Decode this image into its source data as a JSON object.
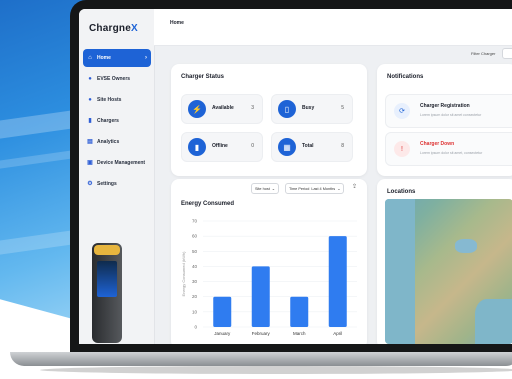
{
  "app": {
    "logo_text": "Chargne",
    "logo_accent": "X",
    "accent_color": "#1e63d6"
  },
  "sidebar": {
    "items": [
      {
        "label": "Home",
        "icon": "home-icon",
        "active": true
      },
      {
        "label": "EVSE Owners",
        "icon": "users-icon"
      },
      {
        "label": "Site Hosts",
        "icon": "user-group-icon"
      },
      {
        "label": "Chargers",
        "icon": "charger-icon"
      },
      {
        "label": "Analytics",
        "icon": "analytics-icon"
      },
      {
        "label": "Device Management",
        "icon": "device-icon"
      },
      {
        "label": "Settings",
        "icon": "gear-icon"
      }
    ]
  },
  "header": {
    "title": "Home",
    "filter_label": "Filter Charger"
  },
  "charger_status": {
    "title": "Charger Status",
    "items": [
      {
        "label": "Available",
        "value": "3",
        "icon": "plug-icon"
      },
      {
        "label": "Busy",
        "value": "5",
        "icon": "battery-icon"
      },
      {
        "label": "Offline",
        "value": "0",
        "icon": "charger-offline-icon"
      },
      {
        "label": "Total",
        "value": "8",
        "icon": "grid-icon"
      }
    ]
  },
  "notifications": {
    "title": "Notifications",
    "items": [
      {
        "title": "Charger Registration",
        "desc": "Lorem ipsum dolor sit amet consectetur",
        "icon": "registration-icon"
      },
      {
        "title": "Charger Down",
        "desc": "Lorem ipsum dolor sit amet, consectetur",
        "icon": "alert-icon"
      }
    ]
  },
  "energy": {
    "title": "Energy Consumed",
    "dropdown_site": "Site host",
    "dropdown_time_label": "Time Period",
    "dropdown_time_value": "Last 4 Months"
  },
  "locations": {
    "title": "Locations"
  },
  "chart_data": {
    "type": "bar",
    "title": "Energy Consumed",
    "categories": [
      "January",
      "February",
      "March",
      "April"
    ],
    "values": [
      20,
      40,
      20,
      60
    ],
    "ylabel": "Energy Consumed (kWh)",
    "xlabel": "",
    "ylim": [
      0,
      70
    ],
    "yticks": [
      0,
      10,
      20,
      30,
      40,
      50,
      60,
      70
    ],
    "bar_color": "#2f7cf0"
  }
}
